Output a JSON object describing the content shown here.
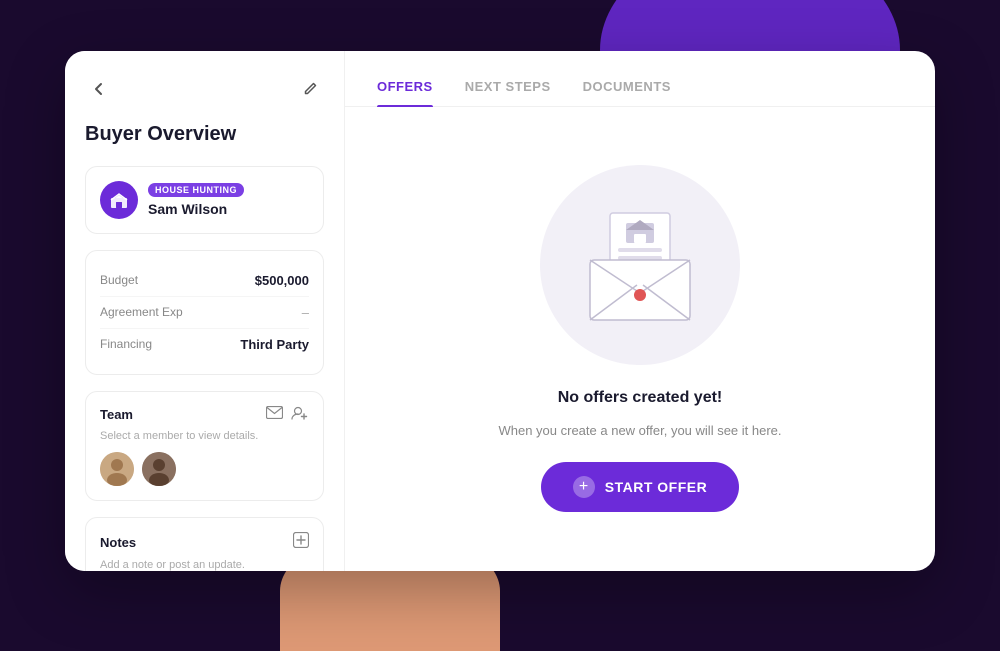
{
  "background": {
    "card_bg": "#ffffff",
    "page_bg": "#1a0a2e"
  },
  "sidebar": {
    "back_icon": "←",
    "edit_icon": "✎",
    "title": "Buyer Overview",
    "buyer": {
      "badge": "HOUSE HUNTING",
      "name": "Sam Wilson",
      "avatar_icon": "🏠"
    },
    "details": [
      {
        "label": "Budget",
        "value": "$500,000",
        "style": "bold"
      },
      {
        "label": "Agreement Exp",
        "value": "–",
        "style": "light"
      },
      {
        "label": "Financing",
        "value": "Third Party",
        "style": "bold"
      }
    ],
    "team": {
      "title": "Team",
      "subtitle": "Select a member to view details.",
      "email_icon": "✉",
      "add_member_icon": "👤+"
    },
    "notes": {
      "title": "Notes",
      "subtitle": "Add a note or post an update.",
      "add_icon": "+"
    }
  },
  "tabs": [
    {
      "id": "offers",
      "label": "OFFERS",
      "active": true
    },
    {
      "id": "next-steps",
      "label": "NEXT STEPS",
      "active": false
    },
    {
      "id": "documents",
      "label": "DOCUMENTS",
      "active": false
    }
  ],
  "empty_state": {
    "title": "No offers created yet!",
    "subtitle": "When you create a new offer, you will see it here.",
    "button_label": "START OFFER"
  }
}
